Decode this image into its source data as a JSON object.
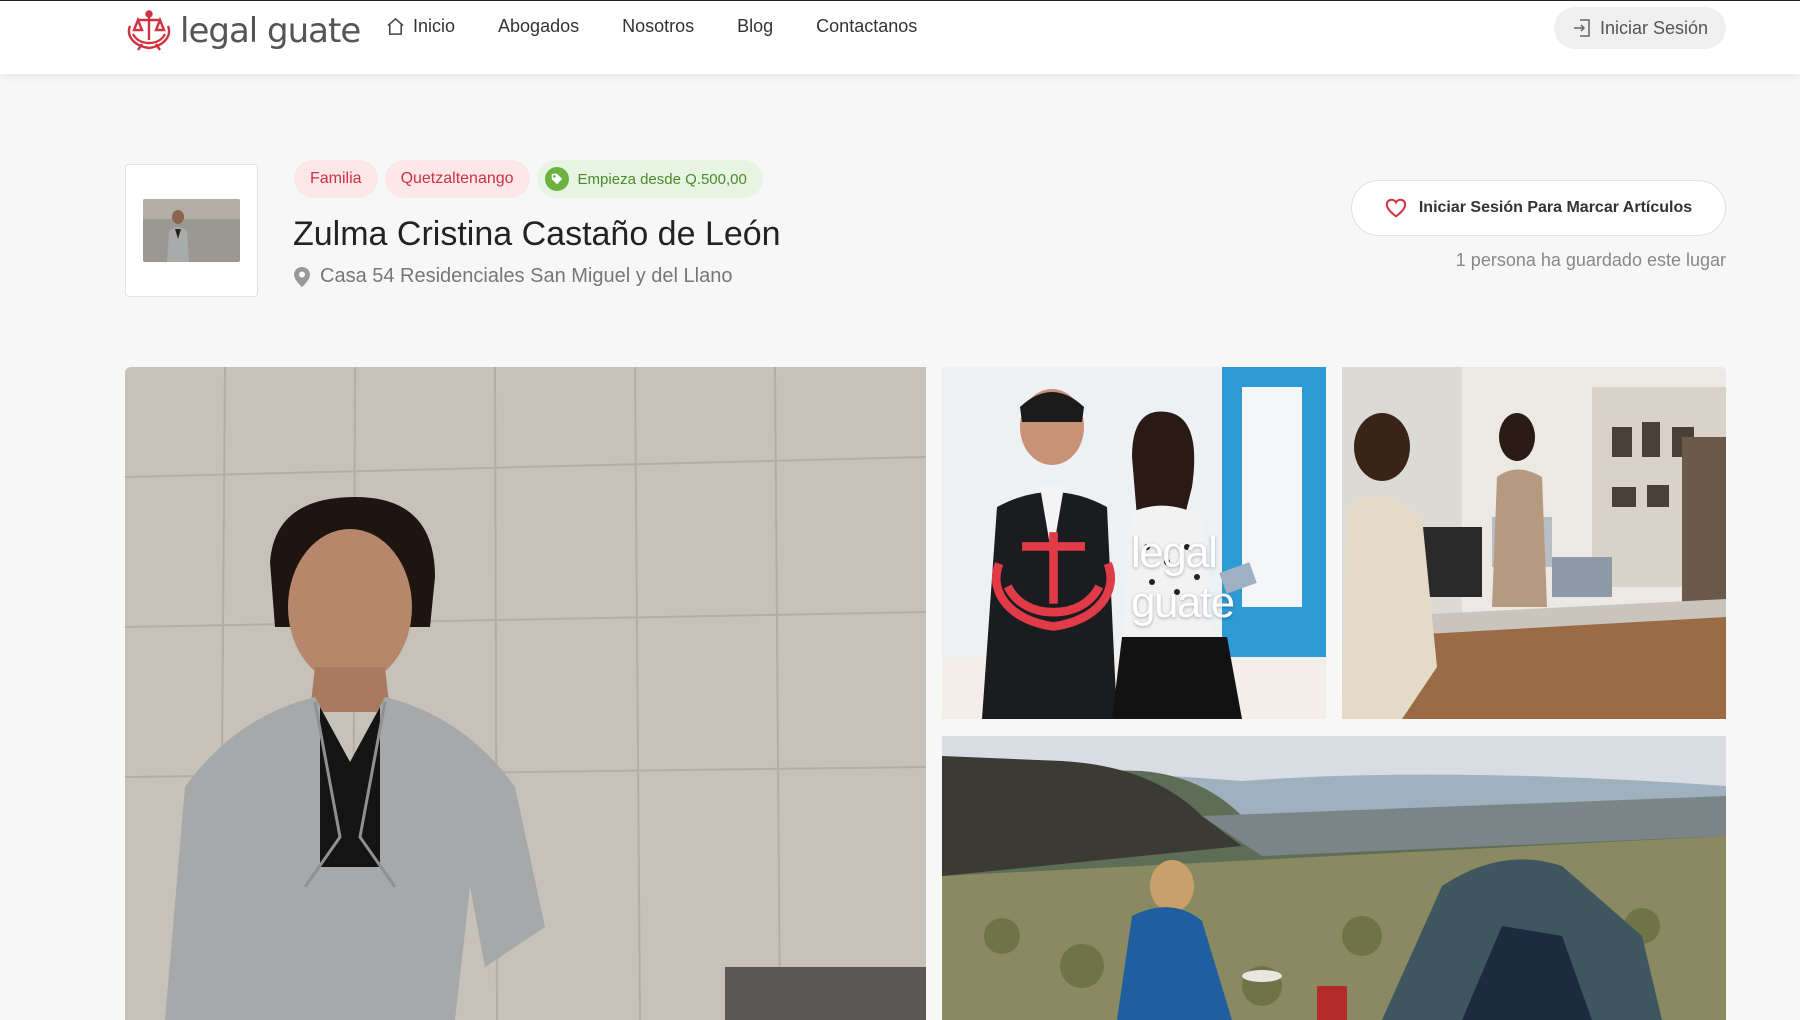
{
  "brand": {
    "logo_text": "legal guate",
    "accent": "#d13240"
  },
  "nav": {
    "items": [
      {
        "label": "Inicio",
        "icon": "home-icon"
      },
      {
        "label": "Abogados"
      },
      {
        "label": "Nosotros"
      },
      {
        "label": "Blog"
      },
      {
        "label": "Contactanos"
      }
    ],
    "login_label": "Iniciar Sesión"
  },
  "listing": {
    "tags": {
      "category": "Familia",
      "location": "Quetzaltenango",
      "price": "Empieza desde Q.500,00"
    },
    "name": "Zulma Cristina Castaño de León",
    "address": "Casa 54 Residenciales San Miguel y del Llano",
    "bookmark_label": "Iniciar Sesión Para Marcar Artículos",
    "saved_text": "1 persona ha guardado este lugar"
  },
  "gallery": {
    "watermark_text": "legal guate"
  }
}
